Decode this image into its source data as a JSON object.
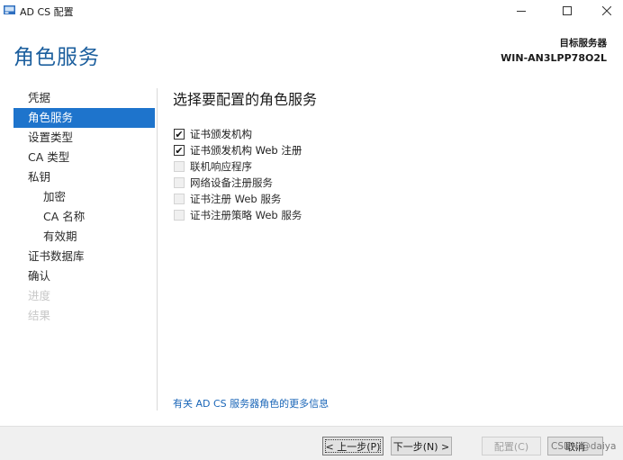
{
  "window": {
    "title": "AD CS 配置",
    "controls": {
      "minimize": "—",
      "maximize": "☐",
      "close": "✕"
    }
  },
  "header": {
    "title": "角色服务",
    "target_label": "目标服务器",
    "target_value": "WIN-AN3LPP78O2L"
  },
  "nav": {
    "items": [
      {
        "label": "凭据",
        "state": "normal"
      },
      {
        "label": "角色服务",
        "state": "active"
      },
      {
        "label": "设置类型",
        "state": "normal"
      },
      {
        "label": "CA 类型",
        "state": "normal"
      },
      {
        "label": "私钥",
        "state": "normal"
      },
      {
        "label": "加密",
        "state": "sub"
      },
      {
        "label": "CA 名称",
        "state": "sub"
      },
      {
        "label": "有效期",
        "state": "sub"
      },
      {
        "label": "证书数据库",
        "state": "normal"
      },
      {
        "label": "确认",
        "state": "normal"
      },
      {
        "label": "进度",
        "state": "disabled"
      },
      {
        "label": "结果",
        "state": "disabled"
      }
    ]
  },
  "content": {
    "title": "选择要配置的角色服务",
    "roles": [
      {
        "label": "证书颁发机构",
        "checked": true
      },
      {
        "label": "证书颁发机构 Web 注册",
        "checked": true
      },
      {
        "label": "联机响应程序",
        "checked": false
      },
      {
        "label": "网络设备注册服务",
        "checked": false
      },
      {
        "label": "证书注册 Web 服务",
        "checked": false
      },
      {
        "label": "证书注册策略 Web 服务",
        "checked": false
      }
    ],
    "more_info_link": "有关 AD CS 服务器角色的更多信息"
  },
  "footer": {
    "prev_label": "< 上一步(P)",
    "next_label": "下一步(N) >",
    "install_label": "配置(C)",
    "cancel_label": "取消"
  },
  "watermark": "CSDN @daiya"
}
